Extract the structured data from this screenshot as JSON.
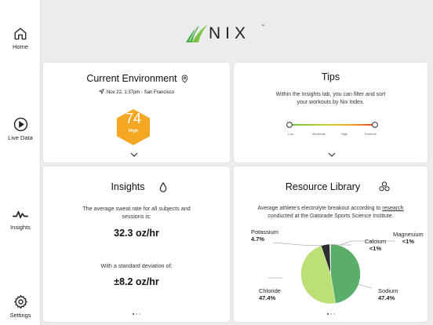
{
  "nav": {
    "home": "Home",
    "live_data": "Live Data",
    "insights": "Insights",
    "settings": "Settings"
  },
  "logo": {
    "text": "NIX",
    "tm": "™"
  },
  "environment": {
    "title": "Current Environment",
    "timestamp": "Nov 22, 1:37pm - San Francisco",
    "score": "74",
    "level": "High",
    "score_color": "#f5a623"
  },
  "tips": {
    "title": "Tips",
    "text_line1": "Within the Insights tab, you can filter and sort",
    "text_line2": "your workouts by Nix Index.",
    "scale_labels": [
      "Low",
      "Moderate",
      "High",
      "Extreme"
    ]
  },
  "insights": {
    "title": "Insights",
    "sweat_line1": "The average sweat rate for all subjects and",
    "sweat_line2": "sessions is:",
    "sweat_value": "32.3 oz/hr",
    "std_label": "With a standard deviation of:",
    "std_value": "±8.2 oz/hr"
  },
  "library": {
    "title": "Resource Library",
    "text_line1_prefix": "Average athlete's electrolyte breakout according to ",
    "text_link": "research",
    "text_line2": "conducted at the Gatorade Sports Science Institute."
  },
  "chart_data": {
    "type": "pie",
    "slices": [
      {
        "label": "Sodium",
        "value": "47.4%",
        "percent": 47.4,
        "color": "#5aae6a"
      },
      {
        "label": "Chloride",
        "value": "47.4%",
        "percent": 47.4,
        "color": "#bcdf76"
      },
      {
        "label": "Potassium",
        "value": "4.7%",
        "percent": 4.7,
        "color": "#2d2d2d"
      },
      {
        "label": "Calcium",
        "value": "<1%",
        "percent": 0.25,
        "color": "#9a9a9a"
      },
      {
        "label": "Magnesium",
        "value": "<1%",
        "percent": 0.25,
        "color": "#c8c8c8"
      }
    ]
  }
}
